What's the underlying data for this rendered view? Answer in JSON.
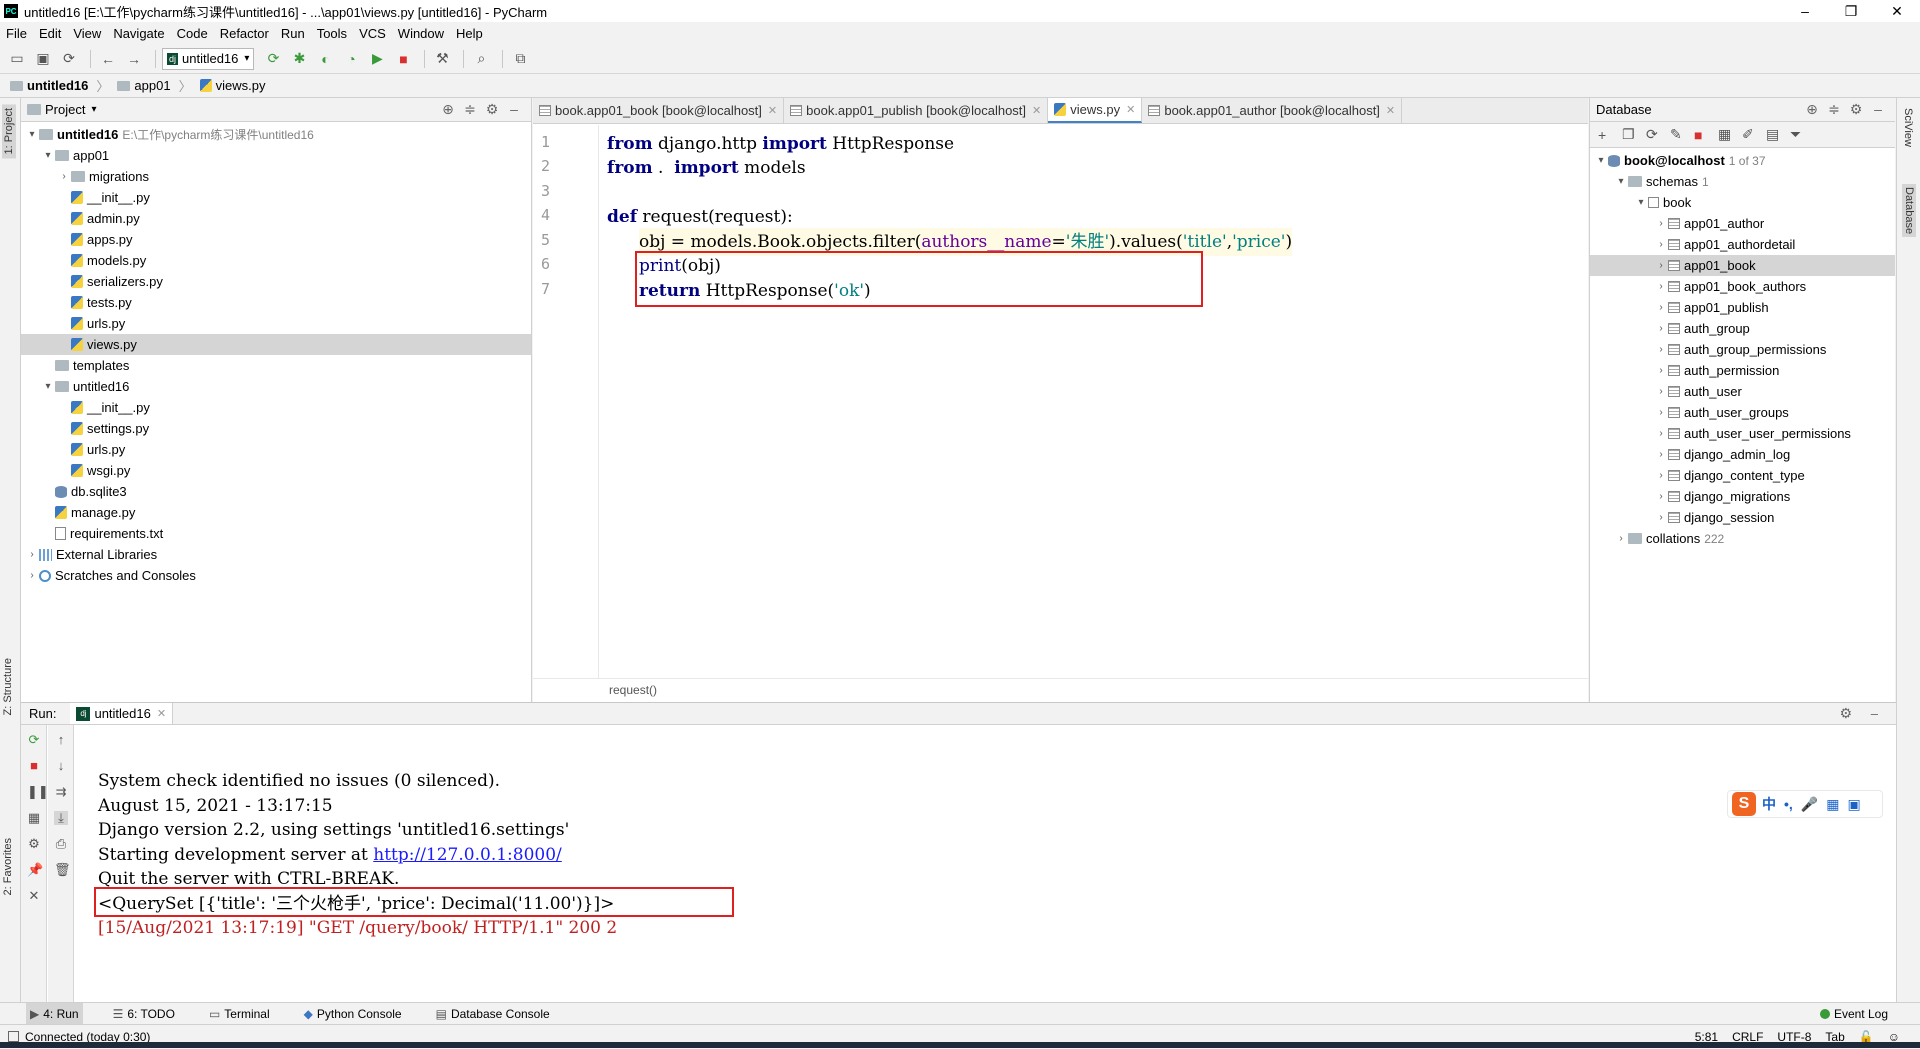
{
  "window": {
    "title": "untitled16 [E:\\工作\\pycharm练习课件\\untitled16] - ...\\app01\\views.py [untitled16] - PyCharm",
    "app_icon": "PC",
    "controls": [
      "–",
      "❐",
      "✕"
    ]
  },
  "menu": [
    "File",
    "Edit",
    "View",
    "Navigate",
    "Code",
    "Refactor",
    "Run",
    "Tools",
    "VCS",
    "Window",
    "Help"
  ],
  "toolbar": {
    "run_config": "untitled16",
    "django_badge": "dj"
  },
  "breadcrumb": [
    "untitled16",
    "app01",
    "views.py"
  ],
  "left_strip": {
    "project_tab": "1: Project",
    "structure_tab": "Z: Structure",
    "favorites_tab": "2: Favorites"
  },
  "project": {
    "header": "Project",
    "root_name": "untitled16",
    "root_path": "E:\\工作\\pycharm练习课件\\untitled16",
    "items": [
      "app01",
      "migrations",
      "__init__.py",
      "admin.py",
      "apps.py",
      "models.py",
      "serializers.py",
      "tests.py",
      "urls.py",
      "views.py",
      "templates",
      "untitled16",
      "__init__.py",
      "settings.py",
      "urls.py",
      "wsgi.py",
      "db.sqlite3",
      "manage.py",
      "requirements.txt",
      "External Libraries",
      "Scratches and Consoles"
    ]
  },
  "editor": {
    "tabs": [
      "book.app01_book [book@localhost]",
      "book.app01_publish [book@localhost]",
      "views.py",
      "book.app01_author [book@localhost]"
    ],
    "line_numbers": [
      "1",
      "2",
      "3",
      "4",
      "5",
      "6",
      "7"
    ],
    "code": {
      "l1_kw": "from",
      "l1_mod": " django.http ",
      "l1_kw2": "import",
      "l1_rest": " HttpResponse",
      "l2_kw": "from",
      "l2_mod": " .  ",
      "l2_kw2": "import",
      "l2_rest": " models",
      "l4_kw": "def",
      "l4_fn": " request",
      "l4_rest": "(request):",
      "l5_a": "obj = models.Book.objects.filter(",
      "l5_param": "authors__name",
      "l5_eq": "=",
      "l5_s1": "'朱胜'",
      "l5_b": ").values(",
      "l5_s2": "'title'",
      "l5_c": ",",
      "l5_s3": "'price'",
      "l5_d": ")",
      "l6_fn": "print",
      "l6_rest": "(obj)",
      "l7_kw": "return",
      "l7_a": " HttpResponse(",
      "l7_s": "'ok'",
      "l7_b": ")"
    },
    "footer_breadcrumb": "request()"
  },
  "database": {
    "header": "Database",
    "connection": "book@localhost",
    "connection_count": "1 of 37",
    "schemas_label": "schemas",
    "schemas_count": "1",
    "schema": "book",
    "tables": [
      "app01_author",
      "app01_authordetail",
      "app01_book",
      "app01_book_authors",
      "app01_publish",
      "auth_group",
      "auth_group_permissions",
      "auth_permission",
      "auth_user",
      "auth_user_groups",
      "auth_user_user_permissions",
      "django_admin_log",
      "django_content_type",
      "django_migrations",
      "django_session"
    ],
    "collations_label": "collations",
    "collations_count": "222"
  },
  "right_strip": {
    "sciview": "SciView",
    "database": "Database"
  },
  "run": {
    "label": "Run:",
    "tab": "untitled16",
    "output": [
      "System check identified no issues (0 silenced).",
      "August 15, 2021 - 13:17:15",
      "Django version 2.2, using settings 'untitled16.settings'",
      "Starting development server at ",
      "Quit the server with CTRL-BREAK.",
      "<QuerySet [{'title': '三个火枪手', 'price': Decimal('11.00')}]>",
      "[15/Aug/2021 13:17:19] \"GET /query/book/ HTTP/1.1\" 200 2"
    ],
    "server_link": "http://127.0.0.1:8000/"
  },
  "ime": {
    "logo": "S",
    "mode": "中",
    "punct": "•,",
    "mic": "🎤",
    "kbd": "▦",
    "grid": "▣"
  },
  "bottom_tabs": [
    "4: Run",
    "6: TODO",
    "Terminal",
    "Python Console",
    "Database Console"
  ],
  "event_log": "Event Log",
  "status": {
    "left": "Connected (today 0:30)",
    "position": "5:81",
    "line_sep": "CRLF",
    "encoding": "UTF-8",
    "indent": "Tab"
  }
}
